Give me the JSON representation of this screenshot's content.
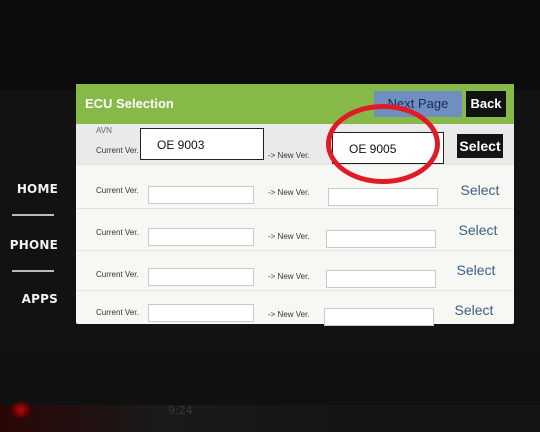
{
  "header": {
    "title": "ECU Selection",
    "next_page_label": "Next Page",
    "back_label": "Back"
  },
  "nav": {
    "items": [
      {
        "label": "HOME"
      },
      {
        "label": "PHONE"
      },
      {
        "label": "APPS"
      }
    ]
  },
  "rows": [
    {
      "ecu_name": "AVN",
      "current_label": "Current Ver.",
      "current_value": "OE 9003",
      "new_label": "-> New Ver.",
      "new_value": "OE 9005",
      "select_label": "Select"
    },
    {
      "ecu_name": "",
      "current_label": "Current Ver.",
      "current_value": "",
      "new_label": "-> New Ver.",
      "new_value": "",
      "select_label": "Select"
    },
    {
      "ecu_name": "",
      "current_label": "Current Ver.",
      "current_value": "",
      "new_label": "-> New Ver.",
      "new_value": "",
      "select_label": "Select"
    },
    {
      "ecu_name": "",
      "current_label": "Current Ver.",
      "current_value": "",
      "new_label": "-> New Ver.",
      "new_value": "",
      "select_label": "Select"
    },
    {
      "ecu_name": "",
      "current_label": "Current Ver.",
      "current_value": "",
      "new_label": "-> New Ver.",
      "new_value": "",
      "select_label": "Select"
    }
  ],
  "bezel": {
    "bottom_text": "9:24"
  },
  "colors": {
    "header_green": "#86b947",
    "highlight_red": "#e01b25",
    "select_blue": "#3d5e86"
  }
}
